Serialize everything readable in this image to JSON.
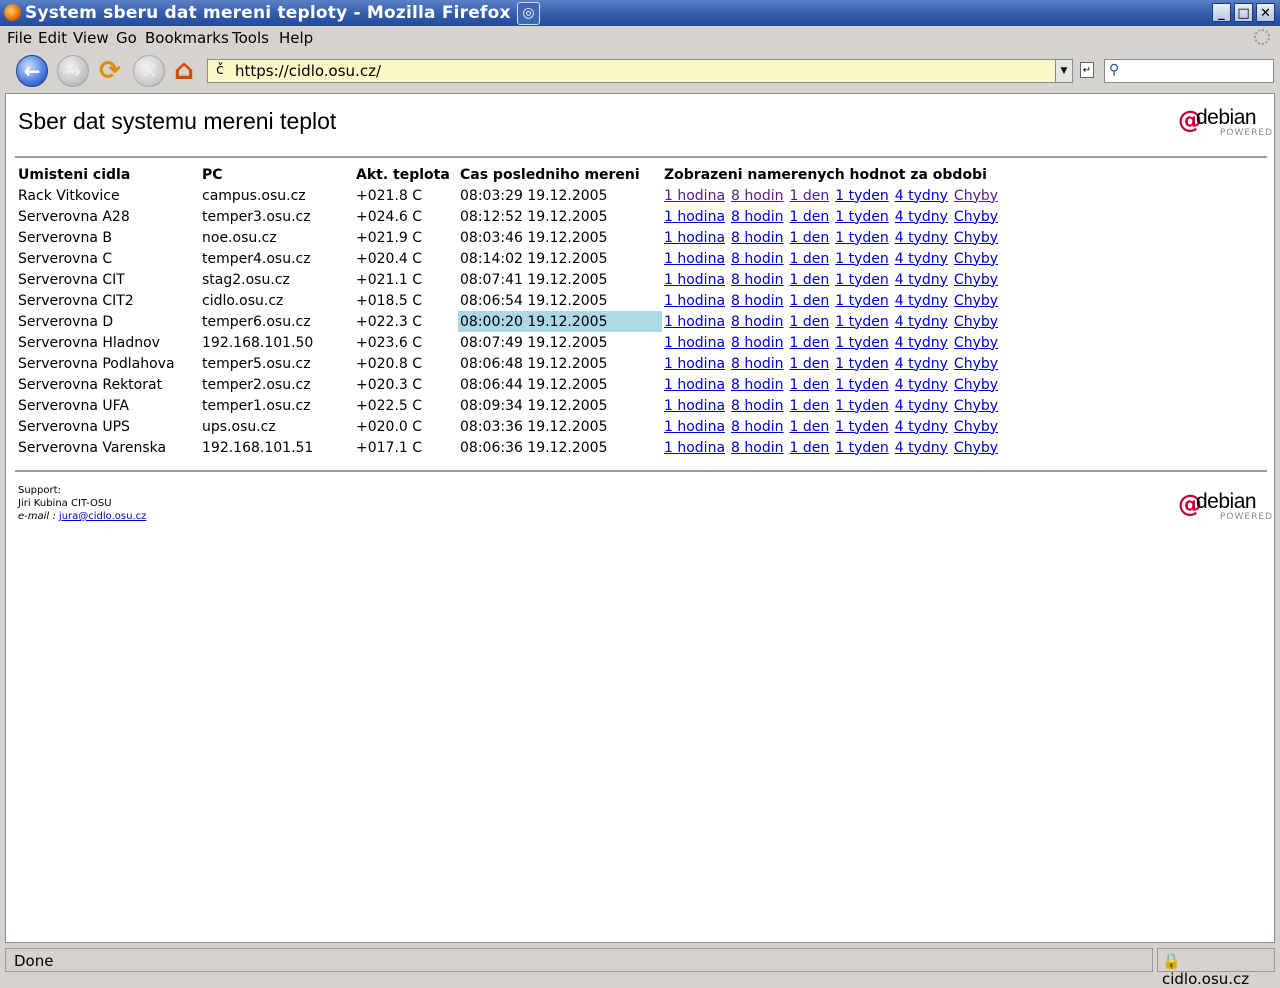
{
  "window": {
    "title": "System sberu dat mereni teploty - Mozilla Firefox",
    "btn_min": "_",
    "btn_max": "□",
    "btn_close": "✕"
  },
  "menu": [
    "File",
    "Edit",
    "View",
    "Go",
    "Bookmarks",
    "Tools",
    "Help"
  ],
  "toolbar": {
    "url_prefix": "č",
    "url": "https://cidlo.osu.cz/"
  },
  "page": {
    "heading": "Sber dat systemu mereni teplot",
    "logo_text": "debian",
    "logo_sub": "POWERED",
    "columns": [
      "Umisteni cidla",
      "PC",
      "Akt. teplota",
      "Cas posledniho mereni",
      "Zobrazeni namerenych hodnot za obdobi"
    ],
    "link_labels": [
      "1 hodina",
      "8 hodin",
      "1 den",
      "1 tyden",
      "4 tydny",
      "Chyby"
    ],
    "rows": [
      {
        "location": "Rack Vitkovice",
        "pc": "campus.osu.cz",
        "temp": "+021.8 C",
        "time": "08:03:29 19.12.2005"
      },
      {
        "location": "Serverovna A28",
        "pc": "temper3.osu.cz",
        "temp": "+024.6 C",
        "time": "08:12:52 19.12.2005"
      },
      {
        "location": "Serverovna B",
        "pc": "noe.osu.cz",
        "temp": "+021.9 C",
        "time": "08:03:46 19.12.2005"
      },
      {
        "location": "Serverovna C",
        "pc": "temper4.osu.cz",
        "temp": "+020.4 C",
        "time": "08:14:02 19.12.2005"
      },
      {
        "location": "Serverovna CIT",
        "pc": "stag2.osu.cz",
        "temp": "+021.1 C",
        "time": "08:07:41 19.12.2005"
      },
      {
        "location": "Serverovna CIT2",
        "pc": "cidlo.osu.cz",
        "temp": "+018.5 C",
        "time": "08:06:54 19.12.2005"
      },
      {
        "location": "Serverovna D",
        "pc": "temper6.osu.cz",
        "temp": "+022.3 C",
        "time": "08:00:20 19.12.2005"
      },
      {
        "location": "Serverovna Hladnov",
        "pc": "192.168.101.50",
        "temp": "+023.6 C",
        "time": "08:07:49 19.12.2005"
      },
      {
        "location": "Serverovna Podlahova",
        "pc": "temper5.osu.cz",
        "temp": "+020.8 C",
        "time": "08:06:48 19.12.2005"
      },
      {
        "location": "Serverovna Rektorat",
        "pc": "temper2.osu.cz",
        "temp": "+020.3 C",
        "time": "08:06:44 19.12.2005"
      },
      {
        "location": "Serverovna UFA",
        "pc": "temper1.osu.cz",
        "temp": "+022.5 C",
        "time": "08:09:34 19.12.2005"
      },
      {
        "location": "Serverovna UPS",
        "pc": "ups.osu.cz",
        "temp": "+020.0 C",
        "time": "08:03:36 19.12.2005"
      },
      {
        "location": "Serverovna Varenska",
        "pc": "192.168.101.51",
        "temp": "+017.1 C",
        "time": "08:06:36 19.12.2005"
      }
    ],
    "highlight_color": "#add8e6",
    "support_label": "Support:",
    "support_name": "Jiri Kubina CIT-OSU",
    "support_email_label": "e-mail :",
    "support_email": "jura@cidlo.osu.cz"
  },
  "status": {
    "text": "Done",
    "domain": "cidlo.osu.cz"
  }
}
